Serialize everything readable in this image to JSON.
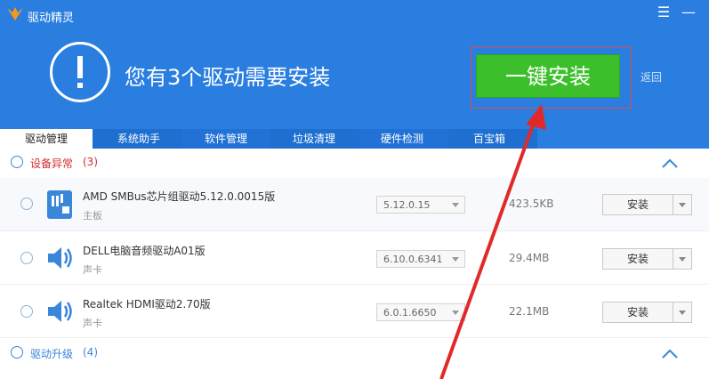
{
  "titlebar": {
    "app_title": "驱动精灵",
    "menu_glyph": "☰",
    "minimize_glyph": "—"
  },
  "banner": {
    "alert_icon": "exclamation-circle-icon",
    "headline": "您有3个驱动需要安装",
    "install_all_label": "一键安装",
    "back_label": "返回"
  },
  "tabs": [
    {
      "label": "驱动管理",
      "active": true
    },
    {
      "label": "系统助手",
      "active": false
    },
    {
      "label": "软件管理",
      "active": false
    },
    {
      "label": "垃圾清理",
      "active": false
    },
    {
      "label": "硬件检测",
      "active": false
    },
    {
      "label": "百宝箱",
      "active": false
    }
  ],
  "sections": {
    "abnormal": {
      "label": "设备异常",
      "count": "(3)",
      "color": "#d42c2c"
    },
    "upgrade": {
      "label": "驱动升级",
      "count": "(4)",
      "color": "#3a86d8"
    }
  },
  "drivers": [
    {
      "name": "AMD SMBus芯片组驱动5.12.0.0015版",
      "type": "主板",
      "version": "5.12.0.15",
      "size": "423.5KB",
      "button": "安装",
      "icon": "motherboard-icon"
    },
    {
      "name": "DELL电脑音频驱动A01版",
      "type": "声卡",
      "version": "6.10.0.6341",
      "size": "29.4MB",
      "button": "安装",
      "icon": "speaker-icon"
    },
    {
      "name": "Realtek HDMI驱动2.70版",
      "type": "声卡",
      "version": "6.0.1.6650",
      "size": "22.1MB",
      "button": "安装",
      "icon": "speaker-icon"
    }
  ],
  "colors": {
    "header_blue": "#2a7ee0",
    "install_green": "#3cbf2b",
    "annotation_red": "#e02a2a"
  }
}
